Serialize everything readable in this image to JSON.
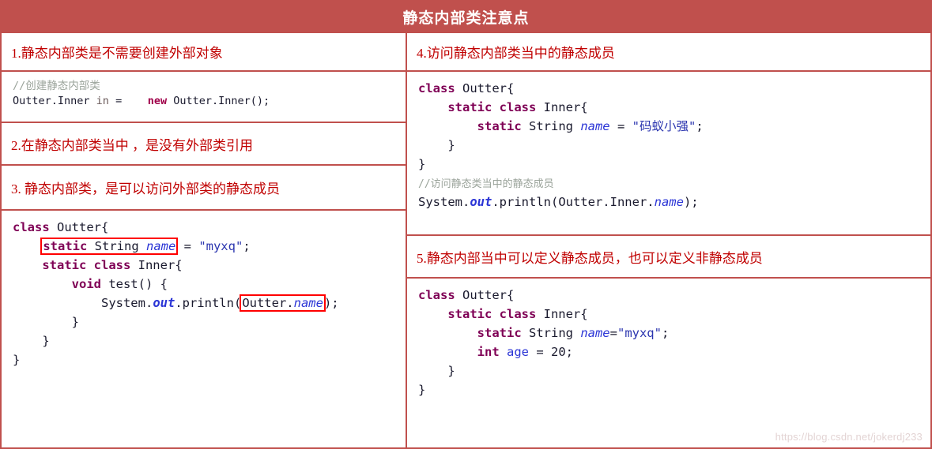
{
  "header": {
    "title": "静态内部类注意点"
  },
  "left_column": {
    "section1": {
      "title": "1.静态内部类是不需要创建外部对象",
      "code": {
        "comment": "//创建静态内部类",
        "line1_a": "Outter.Inner",
        "line1_b": " in ",
        "line1_c": "= ",
        "line1_new": "new",
        "line1_d": " Outter.Inner();"
      }
    },
    "section2": {
      "title": "2.在静态内部类当中 ，是没有外部类引用"
    },
    "section3": {
      "title": "3. 静态内部类，是可以访问外部类的静态成员",
      "code": {
        "l1_kw": "class",
        "l1_rest": " Outter{",
        "l2_box_static": "static",
        "l2_box_string": " String ",
        "l2_box_name": "name",
        "l2_eq": " = ",
        "l2_str": "\"myxq\"",
        "l2_semi": ";",
        "l3_kw": "static class",
        "l3_rest": " Inner{",
        "l4_kw": "void",
        "l4_rest": " test() {",
        "l5_sys": "System.",
        "l5_out": "out",
        "l5_println": ".println(",
        "l5_box_outter": "Outter.",
        "l5_box_name": "name",
        "l5_tail": ");",
        "l6": "}",
        "l7": "}",
        "l8": "}"
      }
    }
  },
  "right_column": {
    "section4": {
      "title": "4.访问静态内部类当中的静态成员",
      "code": {
        "l1_kw": "class",
        "l1_rest": " Outter{",
        "l2_kw": "static class",
        "l2_rest": " Inner{",
        "l3_kw": "static",
        "l3_type": " String ",
        "l3_var": "name",
        "l3_eq": " = ",
        "l3_str": "\"码蚁小强\"",
        "l3_semi": ";",
        "l4": "}",
        "l5": "}",
        "comment": "//访问静态类当中的静态成员",
        "l6_sys": "System.",
        "l6_out": "out",
        "l6_println": ".println(Outter.Inner.",
        "l6_var": "name",
        "l6_tail": ");"
      }
    },
    "section5": {
      "title": "5.静态内部当中可以定义静态成员，也可以定义非静态成员",
      "code": {
        "l1_kw": "class",
        "l1_rest": " Outter{",
        "l2_kw": "static class",
        "l2_rest": " Inner{",
        "l3_kw": "static",
        "l3_type": " String ",
        "l3_var": "name",
        "l3_eq": "=",
        "l3_str": "\"myxq\"",
        "l3_semi": ";",
        "l4_kw": "int",
        "l4_var": " age",
        "l4_eq": " = ",
        "l4_num": "20",
        "l4_semi": ";",
        "l5": "}",
        "l6": "}"
      }
    }
  },
  "watermark": {
    "text": "https://blog.csdn.net/jokerdj233"
  },
  "colors": {
    "frame_red": "#c0504d",
    "title_red": "#c00000",
    "keyword_purple": "#7f0055",
    "variable_blue": "#2b35d6",
    "comment_gray": "#9aa39a",
    "highlight_red": "#ff0000"
  }
}
